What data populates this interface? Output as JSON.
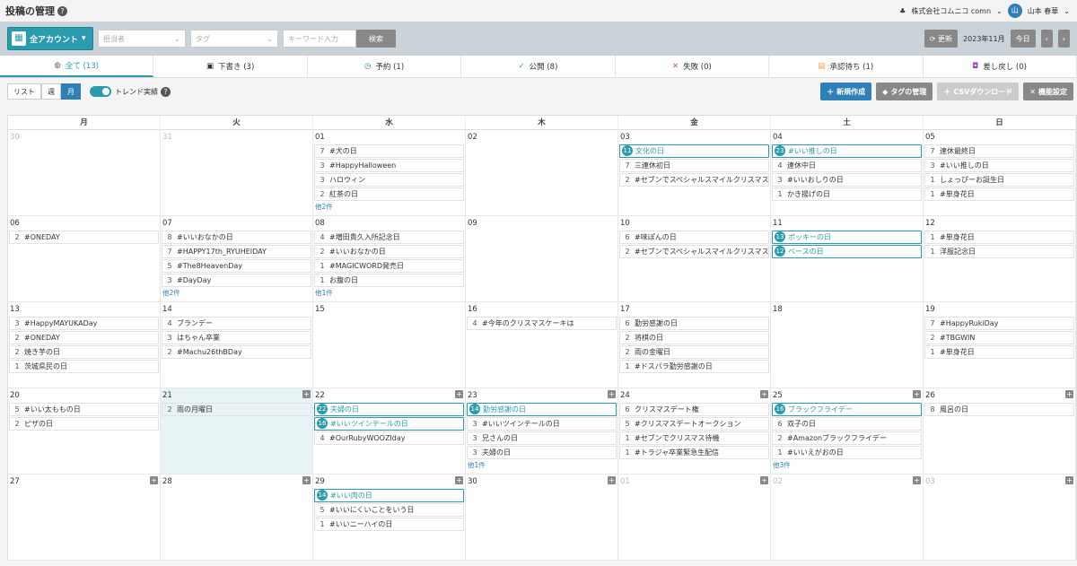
{
  "header": {
    "title": "投稿の管理",
    "company": "株式会社コムニコ comn",
    "user": "山本 春華",
    "avatar": "山"
  },
  "toolbar": {
    "account": "全アカウント",
    "assignee": "担当者",
    "tag": "タグ",
    "keyword": "キーワード入力",
    "search": "検索",
    "refresh": "更新",
    "month": "2023年11月",
    "today": "今日"
  },
  "tabs": [
    {
      "label": "全て (13)",
      "icon": "globe-icon",
      "color": "#555"
    },
    {
      "label": "下書き (3)",
      "icon": "save-icon",
      "color": "#333"
    },
    {
      "label": "予約 (1)",
      "icon": "clock-icon",
      "color": "#2f7fb8"
    },
    {
      "label": "公開 (8)",
      "icon": "check-icon",
      "color": "#2a9bae"
    },
    {
      "label": "失敗 (0)",
      "icon": "x-icon",
      "color": "#d9534f"
    },
    {
      "label": "承認待ち (1)",
      "icon": "approval-icon",
      "color": "#f0a030"
    },
    {
      "label": "差し戻し (0)",
      "icon": "return-icon",
      "color": "#9b3bbf"
    }
  ],
  "view": {
    "list": "リスト",
    "week": "週",
    "month": "月",
    "trend": "トレンド実績",
    "new": "新規作成",
    "tags": "タグの管理",
    "csv": "CSVダウンロード",
    "settings": "機能設定"
  },
  "weekdays": [
    "月",
    "火",
    "水",
    "木",
    "金",
    "土",
    "日"
  ],
  "weeks": [
    [
      {
        "d": "30",
        "other": true,
        "events": []
      },
      {
        "d": "31",
        "other": true,
        "events": []
      },
      {
        "d": "01",
        "events": [
          {
            "c": "7",
            "t": "#犬の日"
          },
          {
            "c": "3",
            "t": "#HappyHalloween"
          },
          {
            "c": "3",
            "t": "ハロウィン"
          },
          {
            "c": "2",
            "t": "紅茶の日"
          }
        ],
        "more": "他2件"
      },
      {
        "d": "02",
        "events": []
      },
      {
        "d": "03",
        "events": [
          {
            "c": "11",
            "t": "文化の日",
            "hl": true
          },
          {
            "c": "7",
            "t": "三連休初日"
          },
          {
            "c": "2",
            "t": "#セブンでスペシャルスマイルクリスマス"
          }
        ]
      },
      {
        "d": "04",
        "events": [
          {
            "c": "23",
            "t": "#いい推しの日",
            "hl": true
          },
          {
            "c": "4",
            "t": "連休中日"
          },
          {
            "c": "3",
            "t": "#いいおしりの日"
          },
          {
            "c": "1",
            "t": "かき揚げの日"
          }
        ]
      },
      {
        "d": "05",
        "events": [
          {
            "c": "7",
            "t": "連休最終日"
          },
          {
            "c": "3",
            "t": "#いい推しの日"
          },
          {
            "c": "1",
            "t": "しょっぴーお誕生日"
          },
          {
            "c": "1",
            "t": "#単身花日"
          }
        ]
      }
    ],
    [
      {
        "d": "06",
        "events": [
          {
            "c": "2",
            "t": "#ONEDAY"
          }
        ]
      },
      {
        "d": "07",
        "events": [
          {
            "c": "8",
            "t": "#いいおなかの日"
          },
          {
            "c": "7",
            "t": "#HAPPY17th_RYUHEIDAY"
          },
          {
            "c": "5",
            "t": "#The8HeavenDay"
          },
          {
            "c": "3",
            "t": "#DayDay"
          }
        ],
        "more": "他2件"
      },
      {
        "d": "08",
        "events": [
          {
            "c": "4",
            "t": "#増田貴久入所記念日"
          },
          {
            "c": "2",
            "t": "#いいおなかの日"
          },
          {
            "c": "1",
            "t": "#MAGICWORD発売日"
          },
          {
            "c": "1",
            "t": "お腹の日"
          }
        ],
        "more": "他1件"
      },
      {
        "d": "09",
        "events": []
      },
      {
        "d": "10",
        "events": [
          {
            "c": "6",
            "t": "#味ぽんの日"
          },
          {
            "c": "2",
            "t": "#セブンでスペシャルスマイルクリスマス"
          }
        ]
      },
      {
        "d": "11",
        "events": [
          {
            "c": "13",
            "t": "ポッキーの日",
            "hl": true
          },
          {
            "c": "12",
            "t": "ベースの日",
            "hl": true
          }
        ]
      },
      {
        "d": "12",
        "events": [
          {
            "c": "1",
            "t": "#単身花日"
          },
          {
            "c": "1",
            "t": "洋服記念日"
          }
        ]
      }
    ],
    [
      {
        "d": "13",
        "events": [
          {
            "c": "3",
            "t": "#HappyMAYUKADay"
          },
          {
            "c": "2",
            "t": "#ONEDAY"
          },
          {
            "c": "2",
            "t": "焼き芋の日"
          },
          {
            "c": "1",
            "t": "茨城県民の日"
          }
        ]
      },
      {
        "d": "14",
        "events": [
          {
            "c": "4",
            "t": "ブランデー"
          },
          {
            "c": "3",
            "t": "はちゃん卒業"
          },
          {
            "c": "2",
            "t": "#Machu26thBDay"
          }
        ]
      },
      {
        "d": "15",
        "events": []
      },
      {
        "d": "16",
        "events": [
          {
            "c": "4",
            "t": "#今年のクリスマスケーキは"
          }
        ]
      },
      {
        "d": "17",
        "events": [
          {
            "c": "6",
            "t": "勤労感謝の日"
          },
          {
            "c": "2",
            "t": "将棋の日"
          },
          {
            "c": "2",
            "t": "雨の金曜日"
          },
          {
            "c": "1",
            "t": "#ドスパラ勤労感謝の日"
          }
        ]
      },
      {
        "d": "18",
        "events": []
      },
      {
        "d": "19",
        "events": [
          {
            "c": "7",
            "t": "#HappyRukiDay"
          },
          {
            "c": "2",
            "t": "#TBGWIN"
          },
          {
            "c": "1",
            "t": "#単身花日"
          }
        ]
      }
    ],
    [
      {
        "d": "20",
        "events": [
          {
            "c": "5",
            "t": "#いい太ももの日"
          },
          {
            "c": "2",
            "t": "ピザの日"
          }
        ]
      },
      {
        "d": "21",
        "today": true,
        "plus": true,
        "events": [
          {
            "c": "2",
            "t": "雨の月曜日"
          }
        ]
      },
      {
        "d": "22",
        "plus": true,
        "events": [
          {
            "c": "22",
            "t": "夫婦の日",
            "hl": true
          },
          {
            "c": "16",
            "t": "#いいツインテールの日",
            "hl": true
          },
          {
            "c": "4",
            "t": "#OurRubyWOOZIday"
          }
        ]
      },
      {
        "d": "23",
        "plus": true,
        "events": [
          {
            "c": "14",
            "t": "勤労感謝の日",
            "hl": true
          },
          {
            "c": "3",
            "t": "#いいツインテールの日"
          },
          {
            "c": "3",
            "t": "兄さんの日"
          },
          {
            "c": "3",
            "t": "夫婦の日"
          }
        ],
        "more": "他1件"
      },
      {
        "d": "24",
        "plus": true,
        "events": [
          {
            "c": "6",
            "t": "クリスマスデート権"
          },
          {
            "c": "5",
            "t": "#クリスマスデートオークション"
          },
          {
            "c": "1",
            "t": "#セブンでクリスマス待機"
          },
          {
            "c": "1",
            "t": "#トラジャ卒業緊急生配信"
          }
        ]
      },
      {
        "d": "25",
        "plus": true,
        "events": [
          {
            "c": "16",
            "t": "ブラックフライデー",
            "hl": true
          },
          {
            "c": "6",
            "t": "双子の日"
          },
          {
            "c": "2",
            "t": "#Amazonブラックフライデー"
          },
          {
            "c": "1",
            "t": "#いいえがおの日"
          }
        ],
        "more": "他3件"
      },
      {
        "d": "26",
        "plus": true,
        "events": [
          {
            "c": "8",
            "t": "風呂の日"
          }
        ]
      }
    ],
    [
      {
        "d": "27",
        "plus": true,
        "events": []
      },
      {
        "d": "28",
        "plus": true,
        "events": []
      },
      {
        "d": "29",
        "plus": true,
        "events": [
          {
            "c": "14",
            "t": "#いい肉の日",
            "hl": true
          },
          {
            "c": "5",
            "t": "#いいにくいことをいう日"
          },
          {
            "c": "1",
            "t": "#いいニーハイの日"
          }
        ]
      },
      {
        "d": "30",
        "plus": true,
        "events": []
      },
      {
        "d": "01",
        "other": true,
        "plus": true,
        "events": []
      },
      {
        "d": "02",
        "other": true,
        "plus": true,
        "events": []
      },
      {
        "d": "03",
        "other": true,
        "plus": true,
        "events": []
      }
    ]
  ]
}
